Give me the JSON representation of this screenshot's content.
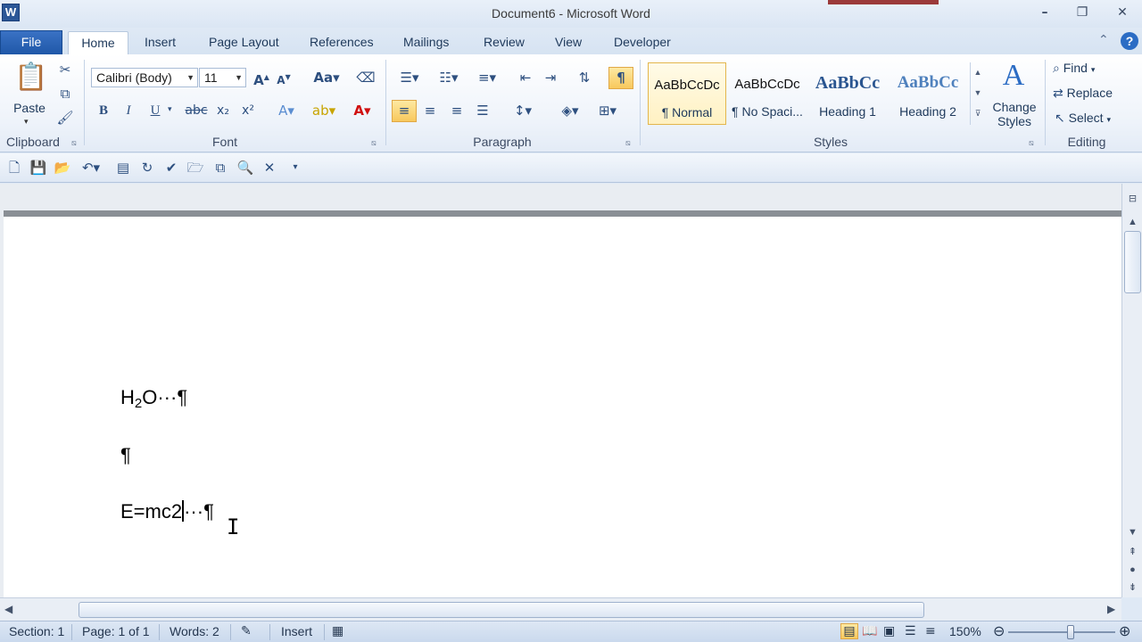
{
  "window": {
    "title": "Document6  -  Microsoft Word",
    "app_letter": "W"
  },
  "tabs": [
    "File",
    "Home",
    "Insert",
    "Page Layout",
    "References",
    "Mailings",
    "Review",
    "View",
    "Developer"
  ],
  "ribbon": {
    "clipboard": {
      "label": "Clipboard",
      "paste_label": "Paste"
    },
    "font": {
      "label": "Font",
      "name": "Calibri (Body)",
      "size": "11"
    },
    "paragraph": {
      "label": "Paragraph"
    },
    "styles": {
      "label": "Styles",
      "items": [
        {
          "sample": "AaBbCcDc",
          "name": "¶ Normal"
        },
        {
          "sample": "AaBbCcDc",
          "name": "¶ No Spaci..."
        },
        {
          "sample": "AaBbCc",
          "name": "Heading 1"
        },
        {
          "sample": "AaBbCc",
          "name": "Heading 2"
        }
      ],
      "change_styles": "Change Styles"
    },
    "editing": {
      "label": "Editing",
      "find": "Find",
      "replace": "Replace",
      "select": "Select"
    }
  },
  "document": {
    "line1_base": "H",
    "line1_sub": "2",
    "line1_rest": "O···¶",
    "line2": "¶",
    "line3_before_caret": "E=mc2",
    "line3_after_caret": "···¶"
  },
  "statusbar": {
    "section": "Section: 1",
    "page": "Page: 1 of 1",
    "words": "Words: 2",
    "mode": "Insert",
    "zoom": "150%"
  }
}
